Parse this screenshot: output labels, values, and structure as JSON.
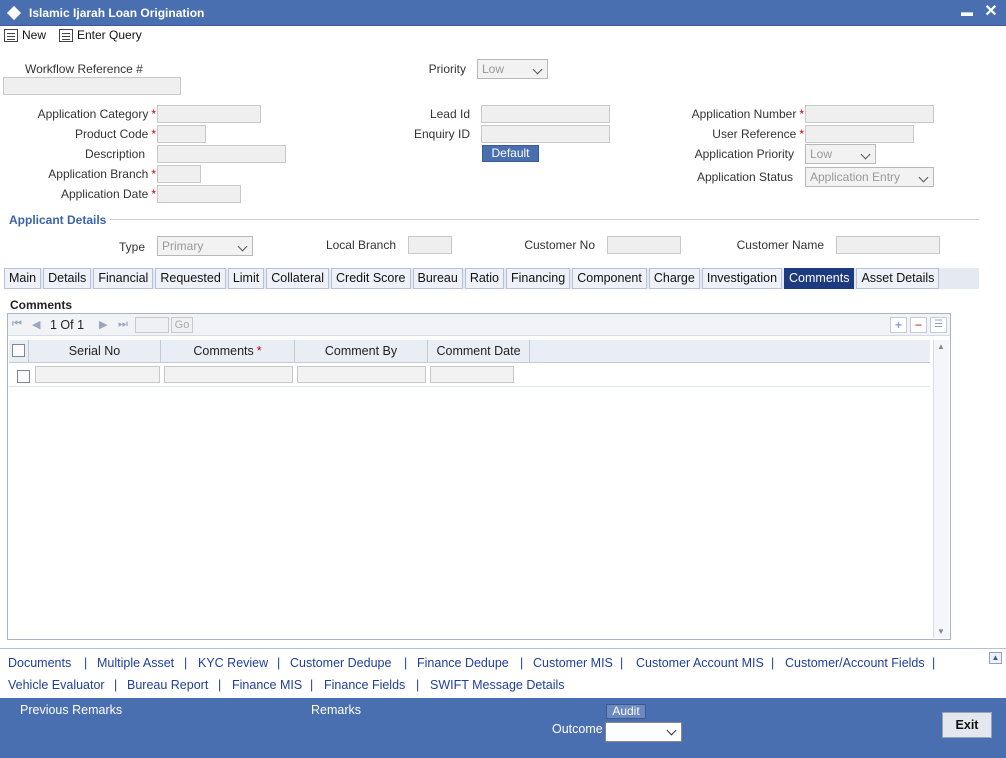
{
  "window": {
    "title": "Islamic Ijarah Loan Origination"
  },
  "toolbar": {
    "new_label": "New",
    "enter_query_label": "Enter Query"
  },
  "header_form": {
    "workflow_ref_label": "Workflow Reference #",
    "priority_label": "Priority",
    "priority_value": "Low",
    "app_category_label": "Application Category",
    "product_code_label": "Product Code",
    "description_label": "Description",
    "app_branch_label": "Application Branch",
    "app_date_label": "Application Date",
    "lead_id_label": "Lead Id",
    "enquiry_id_label": "Enquiry ID",
    "default_button": "Default",
    "app_number_label": "Application Number",
    "user_reference_label": "User Reference",
    "app_priority_label": "Application Priority",
    "app_priority_value": "Low",
    "app_status_label": "Application Status",
    "app_status_value": "Application Entry",
    "required_mark": "*"
  },
  "applicant": {
    "section_title": "Applicant Details",
    "type_label": "Type",
    "type_value": "Primary",
    "local_branch_label": "Local Branch",
    "customer_no_label": "Customer No",
    "customer_name_label": "Customer Name"
  },
  "tabs": [
    "Main",
    "Details",
    "Financial",
    "Requested",
    "Limit",
    "Collateral",
    "Credit Score",
    "Bureau",
    "Ratio",
    "Financing",
    "Component",
    "Charge",
    "Investigation",
    "Comments",
    "Asset Details"
  ],
  "active_tab": "Comments",
  "comments": {
    "section_title": "Comments",
    "pager_text": "1 Of 1",
    "go_label": "Go",
    "columns": [
      "Serial No",
      "Comments",
      "Comment By",
      "Comment Date"
    ],
    "required_mark": "*"
  },
  "links_row1": [
    "Documents",
    "Multiple Asset",
    "KYC Review",
    "Customer Dedupe",
    "Finance Dedupe",
    "Customer MIS",
    "Customer Account MIS",
    "Customer/Account Fields"
  ],
  "links_row2": [
    "Vehicle Evaluator",
    "Bureau Report",
    "Finance MIS",
    "Finance Fields",
    "SWIFT Message Details"
  ],
  "link_separator": "|",
  "footer": {
    "previous_remarks_label": "Previous Remarks",
    "remarks_label": "Remarks",
    "audit_label": "Audit",
    "outcome_label": "Outcome",
    "exit_label": "Exit"
  },
  "colors": {
    "brand_blue": "#4a6fb0",
    "active_tab": "#1b3a80",
    "link": "#1f3f99",
    "required": "#cc0000"
  }
}
